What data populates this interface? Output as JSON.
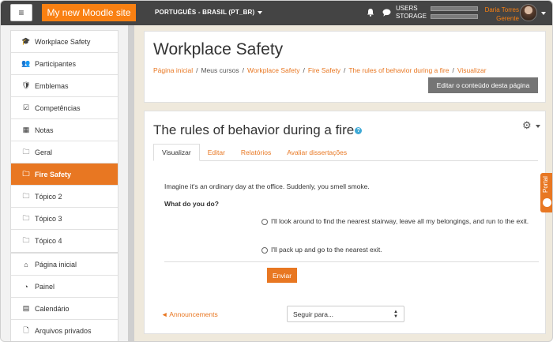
{
  "navbar": {
    "menu_glyph": "≡",
    "site_name": "My new Moodle site",
    "language": "PORTUGUÊS - BRASIL (PT_BR)",
    "users_label": "USERS",
    "storage_label": "STORAGE",
    "user_name": "Daria Torres",
    "user_role": "Gerente"
  },
  "drawer": {
    "course_items": [
      {
        "label": "Workplace Safety",
        "icon": "graduation-cap-icon",
        "glyph": "🎓"
      },
      {
        "label": "Participantes",
        "icon": "users-icon",
        "glyph": "👥"
      },
      {
        "label": "Emblemas",
        "icon": "shield-icon",
        "glyph": "🛡"
      },
      {
        "label": "Competências",
        "icon": "check-square-icon",
        "glyph": "☑"
      },
      {
        "label": "Notas",
        "icon": "table-icon",
        "glyph": "▦"
      },
      {
        "label": "Geral",
        "icon": "folder-icon",
        "glyph": "🗀"
      },
      {
        "label": "Fire Safety",
        "icon": "folder-icon",
        "glyph": "🗀"
      },
      {
        "label": "Tópico 2",
        "icon": "folder-icon",
        "glyph": "🗀"
      },
      {
        "label": "Tópico 3",
        "icon": "folder-icon",
        "glyph": "🗀"
      },
      {
        "label": "Tópico 4",
        "icon": "folder-icon",
        "glyph": "🗀"
      }
    ],
    "site_items": [
      {
        "label": "Página inicial",
        "icon": "home-icon",
        "glyph": "⌂"
      },
      {
        "label": "Painel",
        "icon": "dashboard-icon",
        "glyph": "◔"
      },
      {
        "label": "Calendário",
        "icon": "calendar-icon",
        "glyph": "▤"
      },
      {
        "label": "Arquivos privados",
        "icon": "file-icon",
        "glyph": "🗋"
      }
    ]
  },
  "header": {
    "title": "Workplace Safety",
    "breadcrumb": [
      "Página inicial",
      "Meus cursos",
      "Workplace Safety",
      "Fire Safety",
      "The rules of behavior during a fire",
      "Visualizar"
    ],
    "edit_button": "Editar o conteúdo desta página"
  },
  "main": {
    "title": "The rules of behavior during a fire",
    "help_glyph": "?",
    "gear_glyph": "⚙",
    "tabs": [
      "Visualizar",
      "Editar",
      "Relatórios",
      "Avaliar dissertações"
    ],
    "question": "Imagine it's an ordinary day at the office. Suddenly, you smell smoke.",
    "prompt": "What do you do?",
    "options": [
      "I'll look around to find the nearest stairway, leave all my belongings, and run to the exit.",
      "I'll pack up and go to the nearest exit."
    ],
    "submit": "Enviar",
    "prev_link": "◄ Announcements",
    "jump_to": "Seguir para...",
    "jump_arrows": "▲▼"
  },
  "portal_tab": "Portal",
  "colors": {
    "accent": "#e87722",
    "navbar": "#444444",
    "brand": "#f98012"
  }
}
